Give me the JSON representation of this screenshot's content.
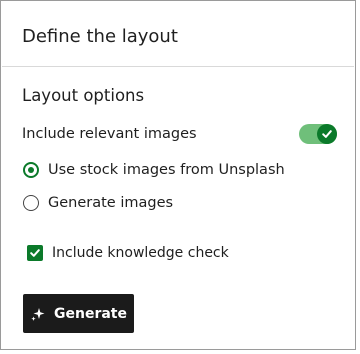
{
  "panel": {
    "title": "Define the layout",
    "section_heading": "Layout options"
  },
  "images_toggle": {
    "label": "Include relevant images",
    "on": true,
    "icon": "check-icon"
  },
  "image_source": {
    "options": [
      {
        "label": "Use stock images from Unsplash",
        "selected": true
      },
      {
        "label": "Generate images",
        "selected": false
      }
    ]
  },
  "knowledge_check": {
    "label": "Include knowledge check",
    "checked": true
  },
  "generate_button": {
    "label": "Generate",
    "icon": "sparkle-icon"
  },
  "colors": {
    "accent_green": "#0b7a2a",
    "toggle_track": "#6fbf7a",
    "button_bg": "#1b1b1b"
  }
}
